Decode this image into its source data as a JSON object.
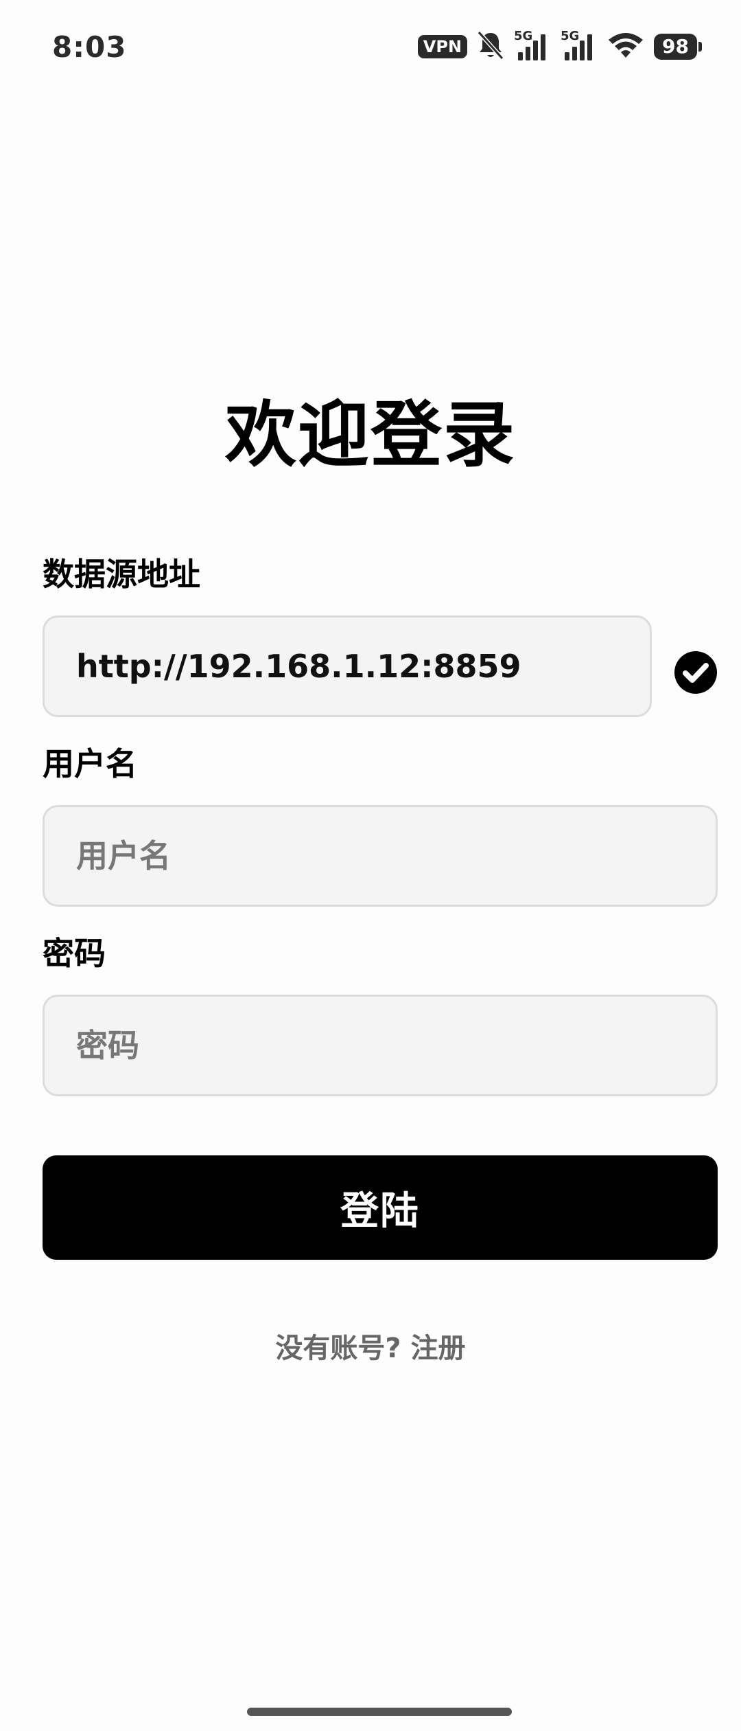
{
  "status_bar": {
    "time": "8:03",
    "vpn": "VPN",
    "sim1_tag": "5G",
    "sim2_tag": "5G",
    "battery": "98",
    "icons": [
      "bell-off-icon",
      "signal-icon",
      "signal-icon",
      "wifi-icon",
      "battery-icon"
    ]
  },
  "title": "欢迎登录",
  "form": {
    "server": {
      "label": "数据源地址",
      "value": "http://192.168.1.12:8859",
      "status_icon": "check-circle-icon"
    },
    "username": {
      "label": "用户名",
      "placeholder": "用户名",
      "value": ""
    },
    "password": {
      "label": "密码",
      "placeholder": "密码",
      "value": ""
    },
    "login_button": "登陆"
  },
  "register_link": "没有账号? 注册",
  "colors": {
    "background": "#fdfdfd",
    "input_bg": "#f3f4f3",
    "input_border": "#dcdcdc",
    "button_bg": "#000000",
    "button_text": "#ffffff",
    "link_text": "#666666"
  }
}
